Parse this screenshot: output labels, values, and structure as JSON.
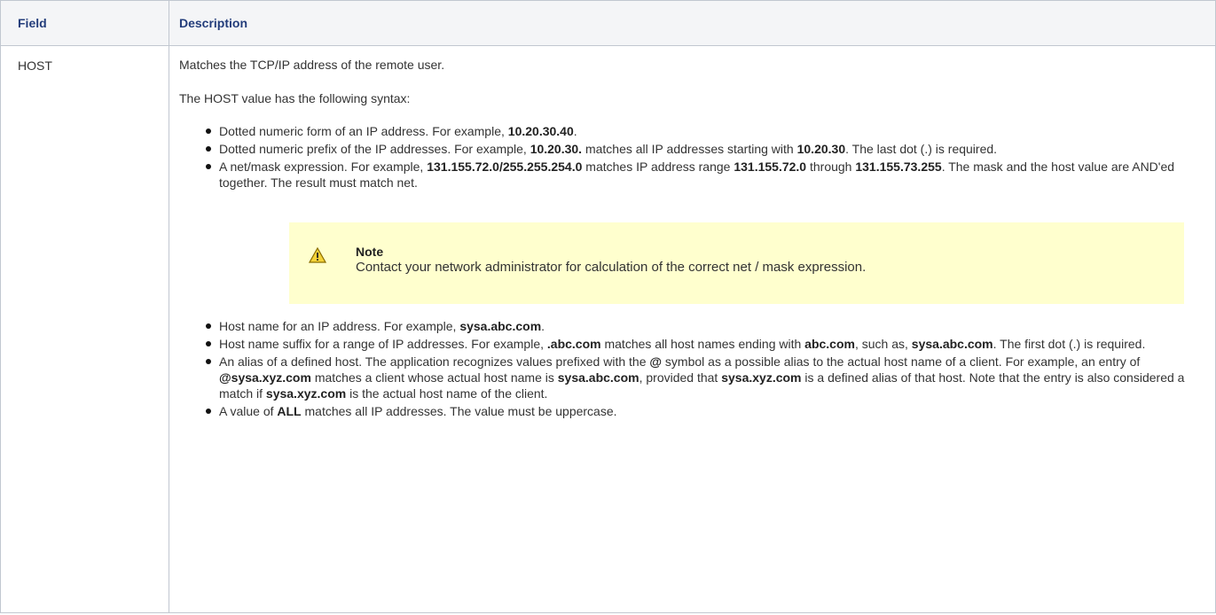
{
  "table": {
    "headers": [
      "Field",
      "Description"
    ],
    "field": "HOST",
    "intro1": "Matches the TCP/IP address of the remote user.",
    "intro2": "The HOST value has the following syntax:",
    "bullets1": [
      [
        {
          "t": "Dotted numeric form of an IP address. For example, "
        },
        {
          "t": "10.20.30.40",
          "b": true
        },
        {
          "t": "."
        }
      ],
      [
        {
          "t": "Dotted numeric prefix of the IP addresses. For example, "
        },
        {
          "t": "10.20.30.",
          "b": true
        },
        {
          "t": " matches all IP addresses starting with "
        },
        {
          "t": "10.20.30",
          "b": true
        },
        {
          "t": ". The last dot (.) is required."
        }
      ],
      [
        {
          "t": "A net/mask expression. For example, "
        },
        {
          "t": "131.155.72.0/255.255.254.0",
          "b": true
        },
        {
          "t": " matches IP address range "
        },
        {
          "t": "131.155.72.0",
          "b": true
        },
        {
          "t": " through "
        },
        {
          "t": "131.155.73.255",
          "b": true
        },
        {
          "t": ". The mask and the host value are AND'ed together. The result must match net."
        }
      ]
    ],
    "note": {
      "icon": "warning-icon",
      "title": "Note",
      "text": "Contact your network administrator for calculation of the correct net / mask expression."
    },
    "bullets2": [
      [
        {
          "t": "Host name for an IP address. For example, "
        },
        {
          "t": "sysa.abc.com",
          "b": true
        },
        {
          "t": "."
        }
      ],
      [
        {
          "t": "Host name suffix for a range of IP addresses. For example, "
        },
        {
          "t": ".abc.com",
          "b": true
        },
        {
          "t": " matches all host names ending with "
        },
        {
          "t": "abc.com",
          "b": true
        },
        {
          "t": ", such as, "
        },
        {
          "t": "sysa.abc.com",
          "b": true
        },
        {
          "t": ". The first dot (.) is required."
        }
      ],
      [
        {
          "t": "An alias of a defined host. The application recognizes values prefixed with the "
        },
        {
          "t": "@",
          "b": true
        },
        {
          "t": " symbol as a possible alias to the actual host name of a client. For example, an entry of "
        },
        {
          "t": "@sysa.xyz.com",
          "b": true
        },
        {
          "t": " matches a client whose actual host name is "
        },
        {
          "t": "sysa.abc.com",
          "b": true
        },
        {
          "t": ", provided that "
        },
        {
          "t": "sysa.xyz.com",
          "b": true
        },
        {
          "t": " is a defined alias of that host. Note that the entry is also considered a match if "
        },
        {
          "t": "sysa.xyz.com",
          "b": true
        },
        {
          "t": " is the actual host name of the client."
        }
      ],
      [
        {
          "t": "A value of "
        },
        {
          "t": "ALL",
          "b": true
        },
        {
          "t": " matches all IP addresses. The value must be uppercase."
        }
      ]
    ]
  }
}
